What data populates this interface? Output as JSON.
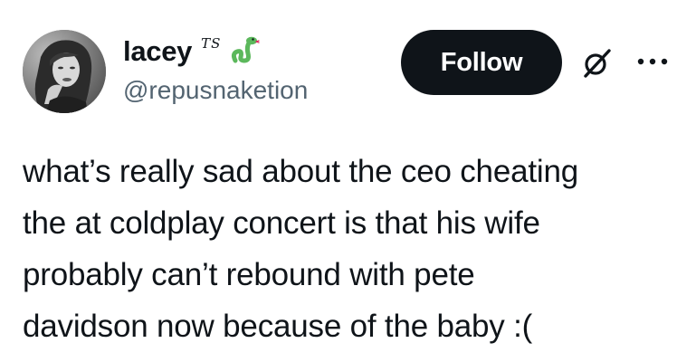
{
  "author": {
    "display_name": "lacey",
    "name_mark": "TS",
    "name_icon": "snake-icon",
    "handle": "@repusnaketion",
    "avatar": "avatar-photo"
  },
  "actions": {
    "follow_label": "Follow",
    "grok_icon": "grok-icon",
    "more_icon": "more-options-icon"
  },
  "tweet": {
    "lines": [
      "what’s really sad about the ceo cheating",
      "the at coldplay concert is that his wife",
      "probably can’t rebound with pete",
      "davidson now because of the baby :("
    ]
  },
  "colors": {
    "text": "#0f1419",
    "secondary_text": "#536471",
    "follow_bg": "#0f1419",
    "follow_text": "#ffffff",
    "snake_green": "#5cb85c"
  }
}
